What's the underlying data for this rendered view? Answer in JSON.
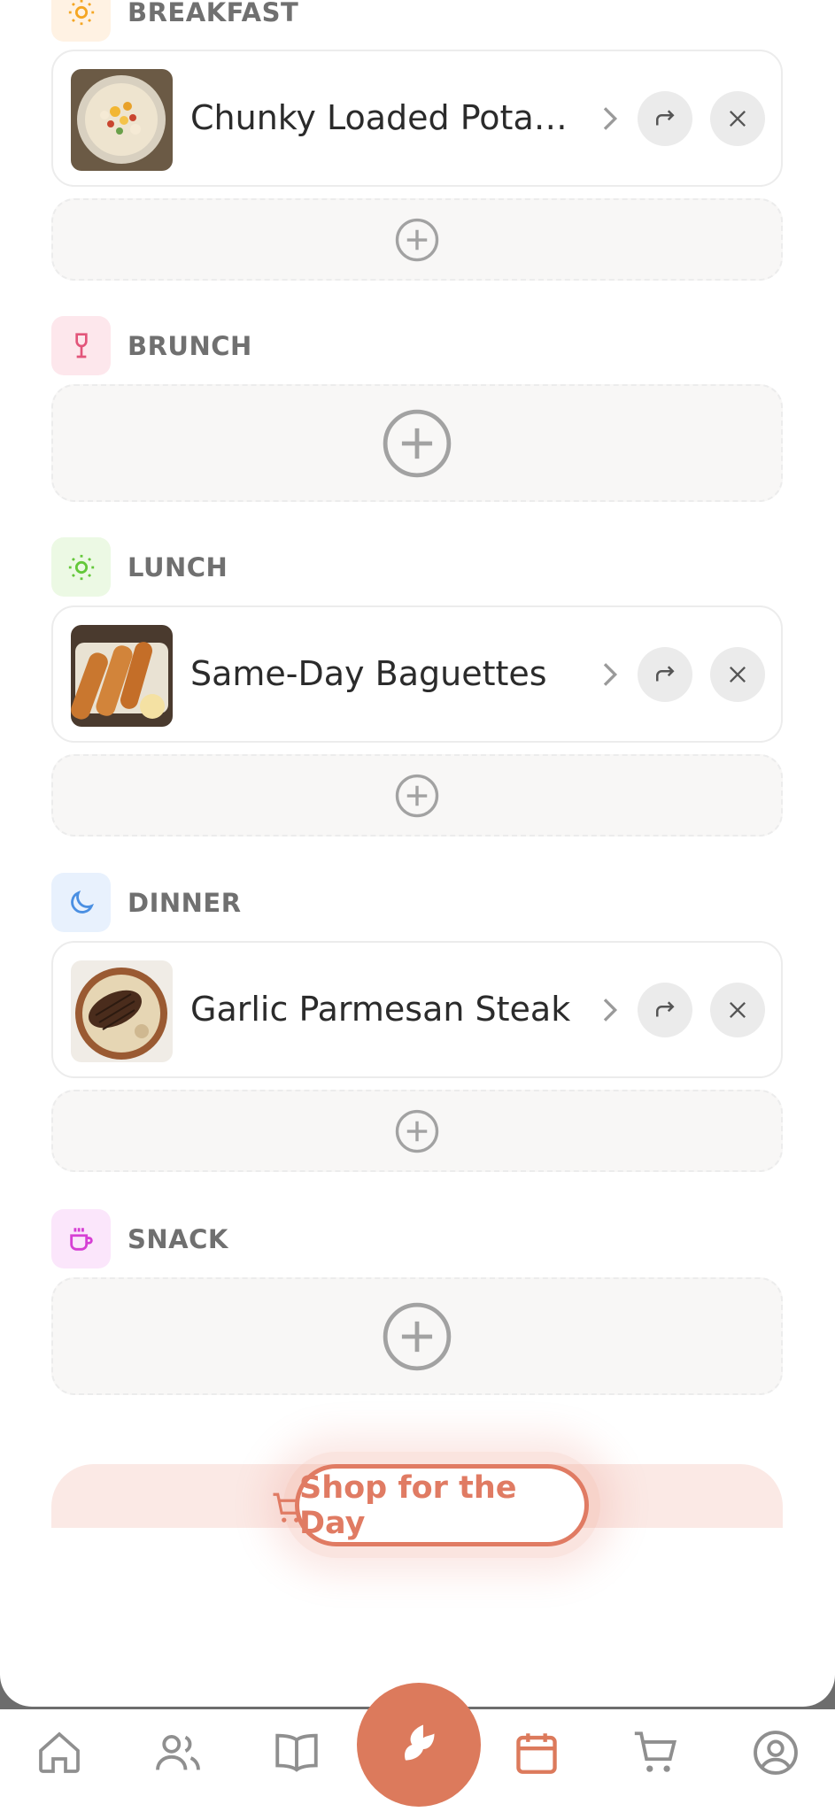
{
  "sections": {
    "breakfast": {
      "label": "BREAKFAST",
      "meal": "Chunky Loaded Potato Soup"
    },
    "brunch": {
      "label": "BRUNCH"
    },
    "lunch": {
      "label": "LUNCH",
      "meal": "Same-Day Baguettes"
    },
    "dinner": {
      "label": "DINNER",
      "meal": "Garlic Parmesan Steak"
    },
    "snack": {
      "label": "SNACK"
    }
  },
  "shop": {
    "label": "Shop for the Day"
  },
  "tabs": [
    "home-icon",
    "users-icon",
    "book-icon",
    "app-logo-icon",
    "calendar-icon",
    "cart-icon",
    "profile-icon"
  ],
  "colors": {
    "accent": "#dc7a5c",
    "active_tab": "#dc7a5c",
    "inactive_tab": "#8f8f8f"
  }
}
